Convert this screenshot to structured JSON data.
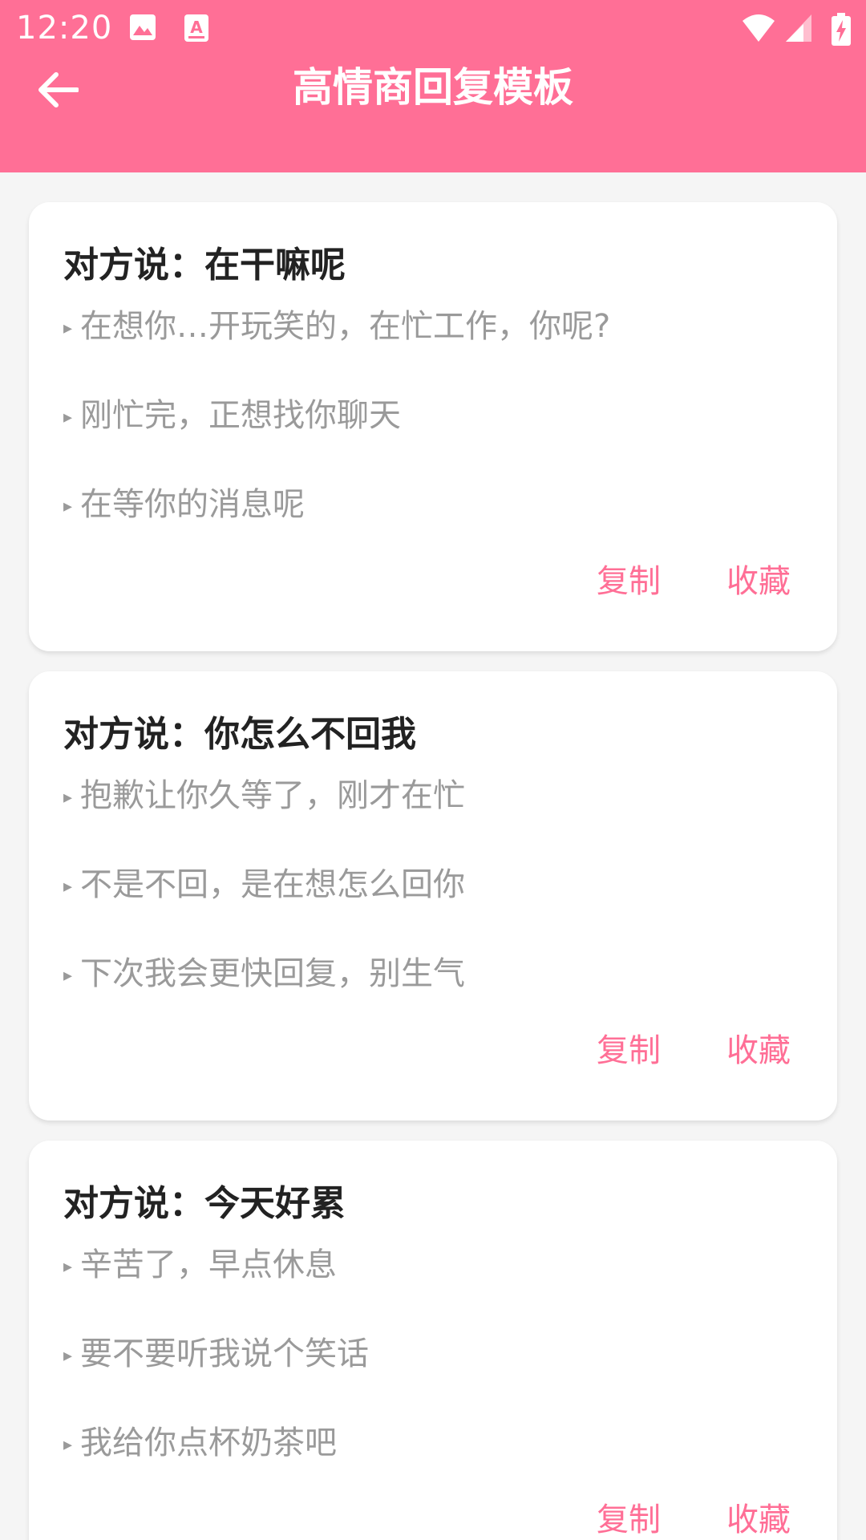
{
  "status_bar": {
    "time": "12:20",
    "icons": [
      "image-icon",
      "keyboard-a-icon",
      "wifi-icon",
      "signal-icon",
      "battery-charging-icon"
    ]
  },
  "toolbar": {
    "title": "高情商回复模板",
    "back_icon": "arrow-left-icon"
  },
  "colors": {
    "accent": "#ff6f96",
    "background": "#f5f5f5",
    "card": "#ffffff",
    "title_text": "#222222",
    "reply_text": "#9a9a9a"
  },
  "cards": [
    {
      "title": "对方说：在干嘛呢",
      "replies": [
        "在想你…开玩笑的，在忙工作，你呢?",
        "刚忙完，正想找你聊天",
        "在等你的消息呢"
      ],
      "copy_label": "复制",
      "favorite_label": "收藏"
    },
    {
      "title": "对方说：你怎么不回我",
      "replies": [
        "抱歉让你久等了，刚才在忙",
        "不是不回，是在想怎么回你",
        "下次我会更快回复，别生气"
      ],
      "copy_label": "复制",
      "favorite_label": "收藏"
    },
    {
      "title": "对方说：今天好累",
      "replies": [
        "辛苦了，早点休息",
        "要不要听我说个笑话",
        "我给你点杯奶茶吧"
      ],
      "copy_label": "复制",
      "favorite_label": "收藏"
    }
  ]
}
